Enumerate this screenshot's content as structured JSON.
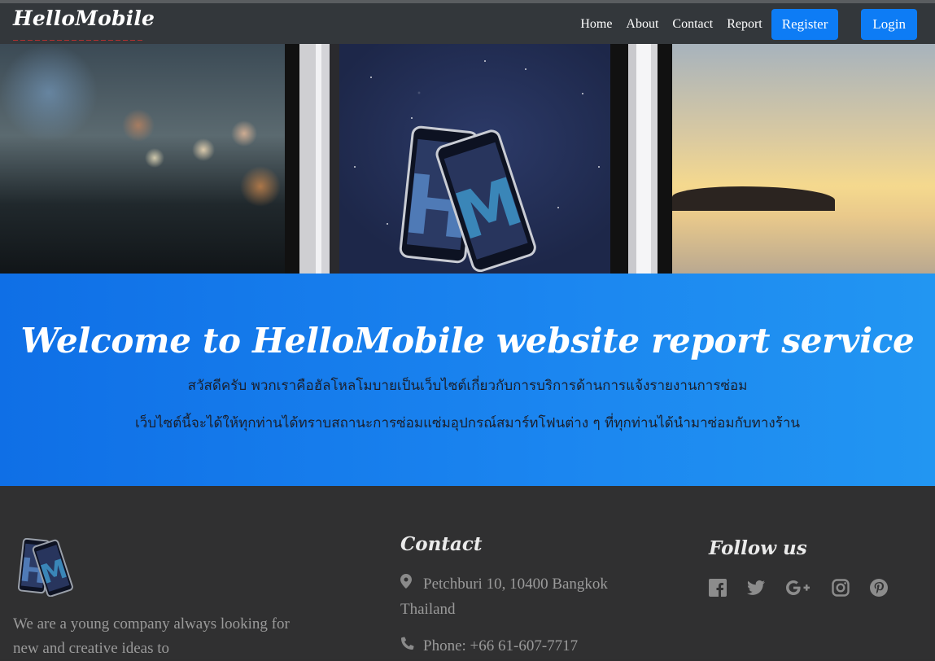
{
  "navbar": {
    "brand": "HelloMobile",
    "links": [
      "Home",
      "About",
      "Contact",
      "Report"
    ],
    "register_label": "Register",
    "login_label": "Login"
  },
  "welcome": {
    "title": "Welcome to HelloMobile website report service",
    "line1": "สวัสดีครับ พวกเราคือฮัลโหลโมบายเป็นเว็บไซต์เกี่ยวกับการบริการด้านการแจ้งรายงานการซ่อม",
    "line2": "เว็บไซต์นี้จะได้ให้ทุกท่านได้ทราบสถานะการซ่อมแซ่มอุปกรณ์สมาร์ทโฟนต่าง ๆ ที่ทุกท่านได้นำมาซ่อมกับทางร้าน"
  },
  "footer": {
    "about_text": "We are a young company always looking for new and creative ideas to",
    "contact_title": "Contact",
    "address": "Petchburi 10, 10400 Bangkok Thailand",
    "phone": "Phone: +66 61-607-7717",
    "follow_title": "Follow us",
    "social_icons": [
      "facebook-icon",
      "twitter-icon",
      "google-plus-icon",
      "instagram-icon",
      "pinterest-icon"
    ]
  },
  "colors": {
    "navbar_bg": "#33373b",
    "button_blue": "#0d7cf5",
    "welcome_gradient_start": "#0f6fe6",
    "welcome_gradient_end": "#2296f2",
    "footer_bg": "#303031"
  }
}
